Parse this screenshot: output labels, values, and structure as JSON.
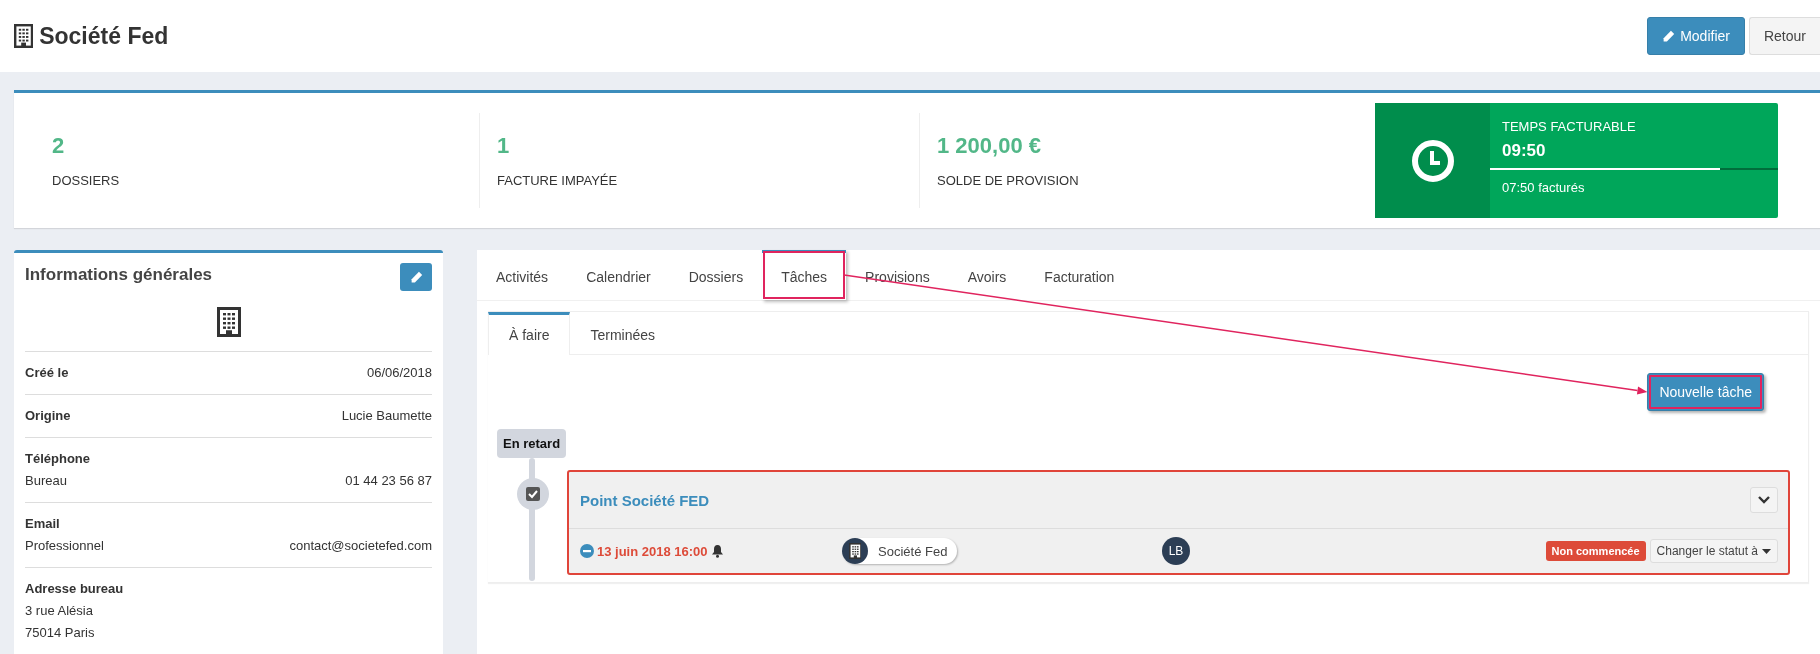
{
  "header": {
    "title": "Société Fed",
    "buttons": [
      {
        "label": "Modifier",
        "kind": "primary"
      },
      {
        "label": "Retour",
        "kind": "default"
      }
    ]
  },
  "stats": [
    {
      "value": "2",
      "label": "DOSSIERS"
    },
    {
      "value": "1",
      "label": "FACTURE IMPAYÉE"
    },
    {
      "value": "1 200,00 €",
      "label": "SOLDE DE PROVISION"
    }
  ],
  "billable": {
    "title": "TEMPS FACTURABLE",
    "total": "09:50",
    "level": 0.8,
    "billed": "07:50 facturés"
  },
  "general_info": {
    "title": "Informations générales",
    "fields": [
      {
        "label": "Créé le",
        "value": "06/06/2018"
      },
      {
        "label": "Origine",
        "value": "Lucie Baumette"
      },
      {
        "label": "Téléphone",
        "sublabel": "Bureau",
        "value": "01 44 23 56 87"
      },
      {
        "label": "Email",
        "sublabel": "Professionnel",
        "value": "contact@societefed.com"
      },
      {
        "label": "Adresse bureau",
        "lines": [
          "3 rue Alésia",
          "75014 Paris"
        ]
      }
    ]
  },
  "tabs": [
    {
      "label": "Activités",
      "selected": false,
      "highlighted": false
    },
    {
      "label": "Calendrier",
      "selected": false,
      "highlighted": false
    },
    {
      "label": "Dossiers",
      "selected": false,
      "highlighted": false
    },
    {
      "label": "Tâches",
      "selected": true,
      "highlighted": true
    },
    {
      "label": "Provisions",
      "selected": false,
      "highlighted": false
    },
    {
      "label": "Avoirs",
      "selected": false,
      "highlighted": false
    },
    {
      "label": "Facturation",
      "selected": false,
      "highlighted": false
    }
  ],
  "subtabs": [
    {
      "label": "À faire",
      "selected": true
    },
    {
      "label": "Terminées",
      "selected": false
    }
  ],
  "new_task_button": {
    "label": "Nouvelle tâche",
    "highlighted": true
  },
  "annotation": {
    "arrow": true
  },
  "groups": [
    {
      "label": "En retard",
      "tasks": [
        {
          "title": "Point Société FED",
          "due": "13 juin 2018 16:00",
          "overdue": true,
          "reminder": true,
          "client": "Société Fed",
          "assignee": "LB",
          "status": "Non commencée",
          "status_menu": "Changer le statut à"
        }
      ]
    }
  ]
}
